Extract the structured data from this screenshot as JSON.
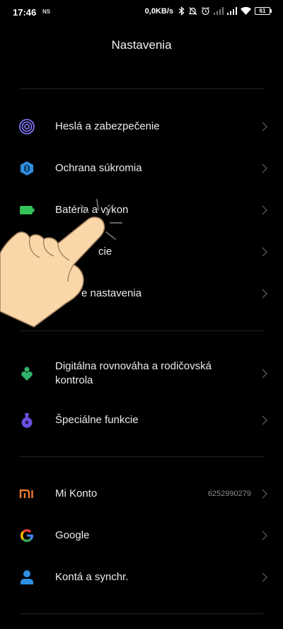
{
  "status_bar": {
    "time": "17:46",
    "ns_label": "NS",
    "net_speed": "0,0KB/s",
    "battery_level": "61"
  },
  "header": {
    "title": "Nastavenia"
  },
  "groups": [
    {
      "items": [
        {
          "label": "Heslá a zabezpečenie",
          "icon": "fingerprint-icon",
          "color": "#7b72f0"
        },
        {
          "label": "Ochrana súkromia",
          "icon": "privacy-shield-icon",
          "color": "#2f8fe3"
        },
        {
          "label": "Batéria a výkon",
          "icon": "battery-icon",
          "color": "#33c35a"
        },
        {
          "label": "cie",
          "icon": "apps-icon",
          "color": "#e8a33d"
        },
        {
          "label": "e nastavenia",
          "icon": "more-settings-icon",
          "color": "#8a8a8a"
        }
      ]
    },
    {
      "items": [
        {
          "label": "Digitálna rovnováha a rodičovská kontrola",
          "icon": "digital-wellbeing-icon",
          "color": "#2fb46a"
        },
        {
          "label": "Špeciálne funkcie",
          "icon": "special-features-icon",
          "color": "#6a4fe0"
        }
      ]
    },
    {
      "items": [
        {
          "label": "Mi Konto",
          "icon": "mi-logo-icon",
          "color": "#f07a2c",
          "value": "6252990279"
        },
        {
          "label": "Google",
          "icon": "google-icon",
          "color": "#4285f4"
        },
        {
          "label": "Kontá a synchr.",
          "icon": "account-sync-icon",
          "color": "#2f8fe3"
        }
      ]
    }
  ],
  "overlay": {
    "icon": "tap-hand-icon"
  }
}
